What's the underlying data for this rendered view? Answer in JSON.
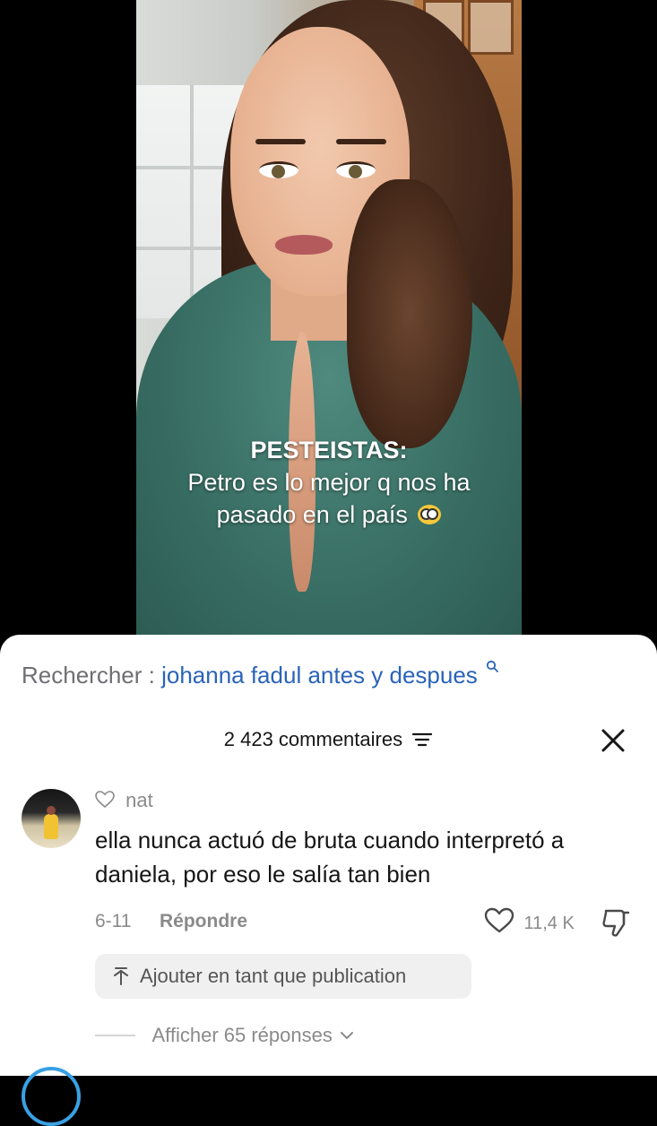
{
  "video": {
    "caption_line1": "PESTEISTAS:",
    "caption_line2": "Petro es lo mejor q nos ha",
    "caption_line3": "pasado en el país",
    "caption_emoji": "flushed-face-emoji"
  },
  "search": {
    "prefix": "Rechercher :",
    "query": "johanna fadul antes y despues",
    "icon": "search-icon"
  },
  "comments": {
    "count_label": "2 423 commentaires",
    "filter_icon": "filter-icon",
    "close_icon": "close-icon"
  },
  "comment": {
    "username": "nat",
    "text": "ella nunca actuó de bruta cuando interpretó a daniela, por eso le salía tan bien",
    "date": "6-11",
    "reply_label": "Répondre",
    "like_count": "11,4 K",
    "add_publication_label": "Ajouter en tant que publication",
    "show_replies_label": "Afficher 65 réponses"
  },
  "colors": {
    "search_query": "#2b63b8",
    "muted_text": "#8a8a8a",
    "story_ring": "#39a0e3"
  }
}
